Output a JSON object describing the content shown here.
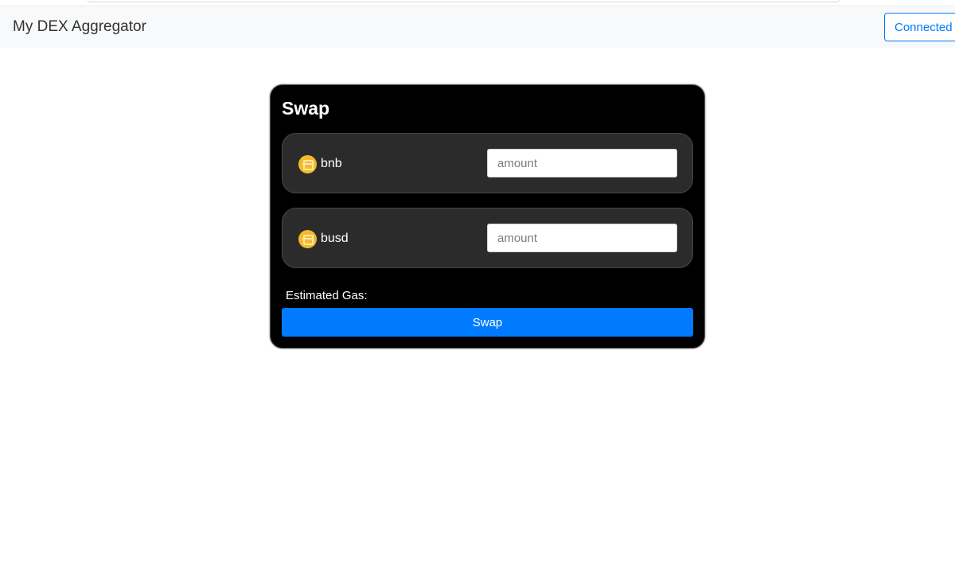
{
  "navbar": {
    "brand": "My DEX Aggregator",
    "connect_label": "Connected"
  },
  "swap": {
    "title": "Swap",
    "from_token": {
      "symbol": "bnb",
      "icon": "bnb-coin-icon",
      "amount_value": "",
      "amount_placeholder": "amount"
    },
    "to_token": {
      "symbol": "busd",
      "icon": "bnb-coin-icon",
      "amount_value": "",
      "amount_placeholder": "amount"
    },
    "gas_label": "Estimated Gas:",
    "button_label": "Swap"
  },
  "colors": {
    "accent": "#007bff",
    "card_bg": "#000000",
    "row_bg": "#2b2b2b",
    "coin": "#f3ba2f"
  }
}
